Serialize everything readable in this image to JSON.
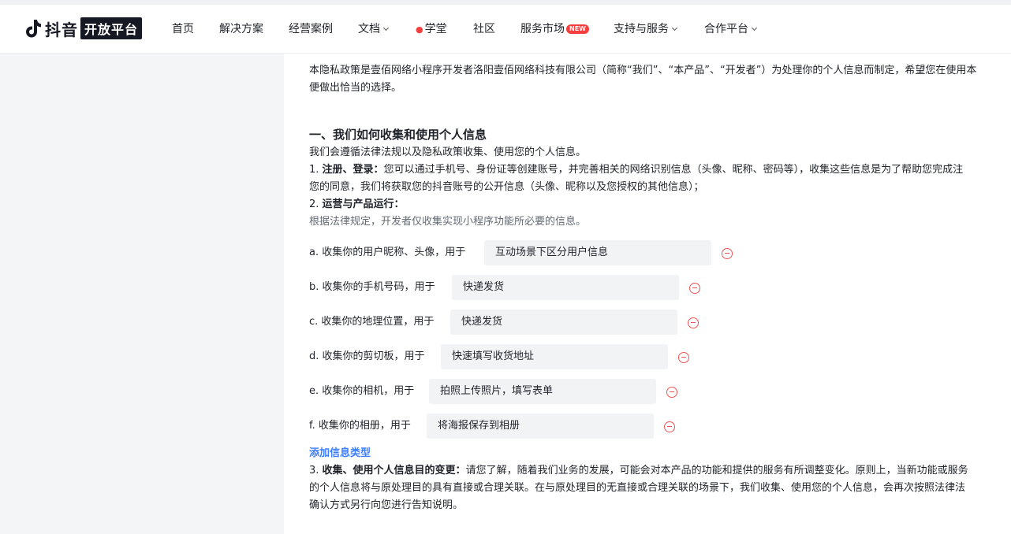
{
  "header": {
    "logo_text": "抖音",
    "logo_badge": "开放平台",
    "nav": {
      "home": "首页",
      "solutions": "解决方案",
      "cases": "经营案例",
      "docs": "文档",
      "academy": "学堂",
      "community": "社区",
      "market": "服务市场",
      "market_badge": "NEW",
      "support": "支持与服务",
      "partner": "合作平台"
    }
  },
  "policy": {
    "intro_1": "本隐私政策是壹佰网络小程序开发者洛阳壹佰网络科技有限公司（简称“我们”、“本产品”、“开发者”）为处理你的个人信息而制定，希望您在使用本",
    "intro_2": "便做出恰当的选择。",
    "section_title": "一、我们如何收集和使用个人信息",
    "section_intro": "我们会遵循法律法规以及隐私政策收集、使用您的个人信息。",
    "item1_prefix": "1. ",
    "item1_bold": "注册、登录：",
    "item1_text": "您可以通过手机号、身份证等创建账号，并完善相关的网络识别信息（头像、昵称、密码等），收集这些信息是为了帮助您完成注",
    "item1_cont": "您的同意，我们将获取您的抖音账号的公开信息（头像、昵称以及您授权的其他信息）；",
    "item2_prefix": "2. ",
    "item2_bold": "运营与产品运行：",
    "item2_note": "根据法律规定，开发者仅收集实现小程序功能所必要的信息。",
    "rows": [
      {
        "label": "a. 收集你的用户昵称、头像，用于",
        "purpose": "互动场景下区分用户信息"
      },
      {
        "label": "b. 收集你的手机号码，用于",
        "purpose": "快递发货"
      },
      {
        "label": "c. 收集你的地理位置，用于",
        "purpose": "快递发货"
      },
      {
        "label": "d. 收集你的剪切板，用于",
        "purpose": "快速填写收货地址"
      },
      {
        "label": "e. 收集你的相机，用于",
        "purpose": "拍照上传照片，填写表单"
      },
      {
        "label": "f. 收集你的相册，用于",
        "purpose": "将海报保存到相册"
      }
    ],
    "add_type": "添加信息类型",
    "item3_prefix": "3. ",
    "item3_bold": "收集、使用个人信息目的变更：",
    "item3_text": "请您了解，随着我们业务的发展，可能会对本产品的功能和提供的服务有所调整变化。原则上，当新功能或服务",
    "item3_cont1": "的个人信息将与原处理目的具有直接或合理关联。在与原处理目的无直接或合理关联的场景下，我们收集、使用您的个人信息，会再次按照法律法",
    "item3_cont2": "确认方式另行向您进行告知说明。"
  }
}
